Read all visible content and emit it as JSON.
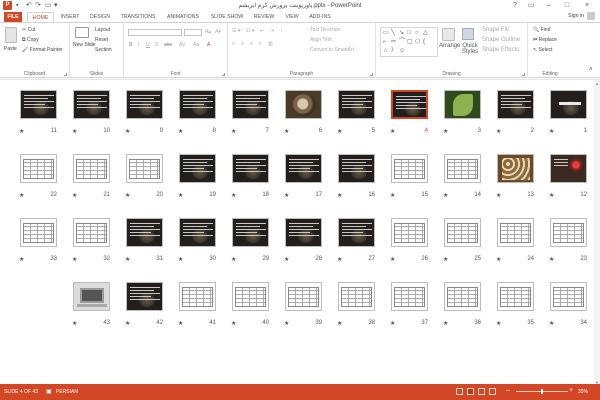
{
  "window": {
    "app_badge": "P",
    "title": "پاورپوینت پرورش کرم ابریشم.pptx - PowerPoint",
    "qat": [
      "save-icon",
      "undo-icon",
      "redo-icon",
      "start-from-beginning-icon",
      "customize-qat-icon"
    ],
    "controls": [
      "?",
      "restore-ribbon-icon",
      "–",
      "□",
      "×"
    ]
  },
  "tabs": [
    "FILE",
    "HOME",
    "INSERT",
    "DESIGN",
    "TRANSITIONS",
    "ANIMATIONS",
    "SLIDE SHOW",
    "REVIEW",
    "VIEW",
    "ADD-INS"
  ],
  "active_tab": "HOME",
  "signin": "Sign in",
  "ribbon": {
    "clipboard": {
      "label": "Clipboard",
      "paste": "Paste",
      "cut": "Cut",
      "copy": "Copy",
      "format_painter": "Format Painter"
    },
    "slides": {
      "label": "Slides",
      "new_slide": "New Slide",
      "layout": "Layout",
      "reset": "Reset",
      "section": "Section"
    },
    "font": {
      "label": "Font",
      "buttons": [
        "B",
        "I",
        "U",
        "S",
        "abc",
        "AV",
        "Aa",
        "A"
      ]
    },
    "paragraph": {
      "label": "Paragraph",
      "text_direction": "Text Direction",
      "align_text": "Align Text",
      "convert_smartart": "Convert to SmartArt"
    },
    "drawing": {
      "label": "Drawing",
      "arrange": "Arrange",
      "quick_styles": "Quick Styles",
      "shape_fill": "Shape Fill",
      "shape_outline": "Shape Outline",
      "shape_effects": "Shape Effects"
    },
    "editing": {
      "label": "Editing",
      "find": "Find",
      "replace": "Replace",
      "select": "Select"
    }
  },
  "slides": [
    {
      "n": "1",
      "kind": "title"
    },
    {
      "n": "2",
      "kind": "text"
    },
    {
      "n": "3",
      "kind": "leaf"
    },
    {
      "n": "4",
      "kind": "text",
      "selected": true
    },
    {
      "n": "5",
      "kind": "text"
    },
    {
      "n": "6",
      "kind": "photo"
    },
    {
      "n": "7",
      "kind": "text"
    },
    {
      "n": "8",
      "kind": "text"
    },
    {
      "n": "9",
      "kind": "text"
    },
    {
      "n": "10",
      "kind": "text"
    },
    {
      "n": "11",
      "kind": "text"
    },
    {
      "n": "12",
      "kind": "berry"
    },
    {
      "n": "13",
      "kind": "fruit"
    },
    {
      "n": "14",
      "kind": "table"
    },
    {
      "n": "15",
      "kind": "table"
    },
    {
      "n": "16",
      "kind": "text"
    },
    {
      "n": "17",
      "kind": "text"
    },
    {
      "n": "18",
      "kind": "text"
    },
    {
      "n": "19",
      "kind": "text"
    },
    {
      "n": "20",
      "kind": "table"
    },
    {
      "n": "21",
      "kind": "table"
    },
    {
      "n": "22",
      "kind": "table"
    },
    {
      "n": "23",
      "kind": "table"
    },
    {
      "n": "24",
      "kind": "table"
    },
    {
      "n": "25",
      "kind": "table"
    },
    {
      "n": "26",
      "kind": "table"
    },
    {
      "n": "27",
      "kind": "text"
    },
    {
      "n": "28",
      "kind": "text"
    },
    {
      "n": "29",
      "kind": "text"
    },
    {
      "n": "30",
      "kind": "text"
    },
    {
      "n": "31",
      "kind": "text"
    },
    {
      "n": "32",
      "kind": "table"
    },
    {
      "n": "33",
      "kind": "table"
    },
    {
      "n": "34",
      "kind": "table"
    },
    {
      "n": "35",
      "kind": "table"
    },
    {
      "n": "36",
      "kind": "table"
    },
    {
      "n": "37",
      "kind": "table"
    },
    {
      "n": "38",
      "kind": "table"
    },
    {
      "n": "39",
      "kind": "table"
    },
    {
      "n": "40",
      "kind": "table"
    },
    {
      "n": "41",
      "kind": "table"
    },
    {
      "n": "42",
      "kind": "text"
    },
    {
      "n": "43",
      "kind": "laptop"
    }
  ],
  "status": {
    "slide": "SLIDE 4 OF 43",
    "language": "PERSIAN",
    "zoom": "35%"
  },
  "colors": {
    "accent": "#d24726",
    "ribbon_bg": "#ffffff",
    "slide_bg": "#221f1c"
  }
}
